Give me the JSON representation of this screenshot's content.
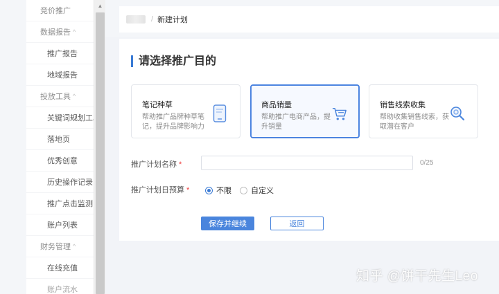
{
  "sidebar": {
    "items": [
      {
        "label": "竞价推广",
        "kind": "section",
        "chevron": ""
      },
      {
        "label": "数据报告",
        "kind": "section",
        "chevron": "^"
      },
      {
        "label": "推广报告",
        "kind": "child"
      },
      {
        "label": "地域报告",
        "kind": "child"
      },
      {
        "label": "投放工具",
        "kind": "section",
        "chevron": "^"
      },
      {
        "label": "关键词规划工具",
        "kind": "child"
      },
      {
        "label": "落地页",
        "kind": "child"
      },
      {
        "label": "优秀创意",
        "kind": "child"
      },
      {
        "label": "历史操作记录",
        "kind": "child"
      },
      {
        "label": "推广点击监测",
        "kind": "child"
      },
      {
        "label": "账户列表",
        "kind": "child"
      },
      {
        "label": "财务管理",
        "kind": "section",
        "chevron": "^"
      },
      {
        "label": "在线充值",
        "kind": "child"
      },
      {
        "label": "账户流水",
        "kind": "child"
      }
    ]
  },
  "breadcrumb": {
    "separator": "/",
    "current": "新建计划"
  },
  "main": {
    "title": "请选择推广目的",
    "goals": [
      {
        "title": "笔记种草",
        "desc": "帮助推广品牌种草笔记，提升品牌影响力",
        "icon": "phone-note-icon",
        "selected": false
      },
      {
        "title": "商品销量",
        "desc": "帮助推广电商产品，提升销量",
        "icon": "shopping-cart-icon",
        "selected": true
      },
      {
        "title": "销售线索收集",
        "desc": "帮助收集销售线索，获取潜在客户",
        "icon": "magnifier-icon",
        "selected": false
      }
    ],
    "plan_name": {
      "label": "推广计划名称",
      "required_mark": "*",
      "value": "",
      "placeholder": "",
      "counter": "0/25"
    },
    "daily_budget": {
      "label": "推广计划日预算",
      "required_mark": "*",
      "options": [
        "不限",
        "自定义"
      ],
      "selected": "不限"
    },
    "buttons": {
      "save": "保存并继续",
      "back": "返回"
    }
  },
  "watermark": "知乎 @饼干先生Leo",
  "colors": {
    "accent": "#4a85dd",
    "selected_border": "#4c84e0",
    "required": "#e33333",
    "background": "#f2f4f8"
  }
}
